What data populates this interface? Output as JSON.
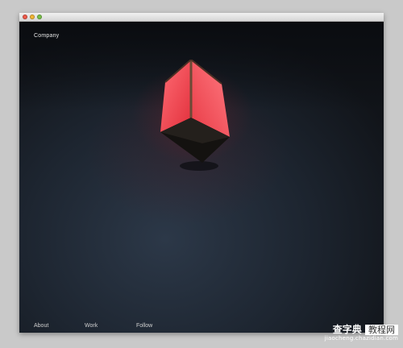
{
  "window": {
    "traffic_lights": [
      "close",
      "minimize",
      "maximize"
    ]
  },
  "site": {
    "brand": "Company",
    "nav": [
      "About",
      "Work",
      "Follow"
    ]
  },
  "hero": {
    "image": "red-hexagonal-lamp",
    "lamp_color": "#ee3b45"
  },
  "watermark": {
    "title": "查字典",
    "box": "教程网",
    "url": "jiaocheng.chazidian.com"
  }
}
